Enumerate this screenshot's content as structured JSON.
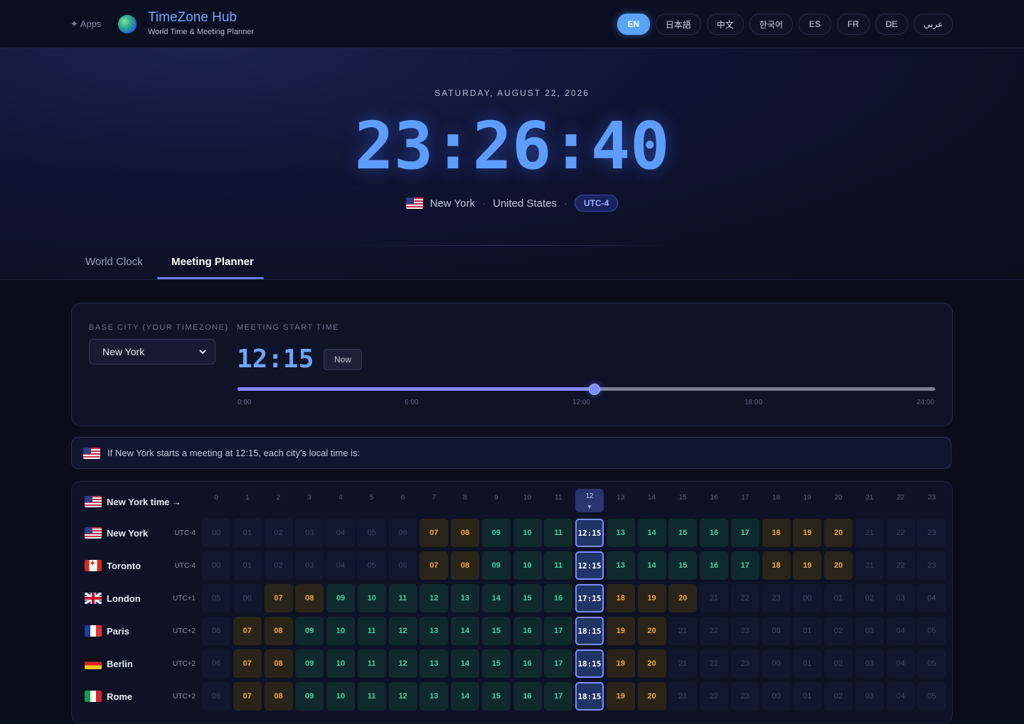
{
  "header": {
    "apps_label": "✦ Apps",
    "brand_title": "TimeZone Hub",
    "brand_subtitle": "World Time & Meeting Planner",
    "languages": [
      "EN",
      "日本語",
      "中文",
      "한국어",
      "ES",
      "FR",
      "DE",
      "عربي"
    ],
    "active_language": "EN"
  },
  "hero": {
    "date": "SATURDAY, AUGUST 22, 2026",
    "time": "23:26:40",
    "city": "New York",
    "country": "United States",
    "utc": "UTC-4"
  },
  "tabs": [
    "World Clock",
    "Meeting Planner"
  ],
  "active_tab": "Meeting Planner",
  "planner": {
    "base_label": "BASE CITY (YOUR TIMEZONE)",
    "base_city": "New York",
    "start_label": "MEETING START TIME",
    "start_time": "12:15",
    "now_label": "Now",
    "slider_value_hours": 12.25,
    "slider_max_hours": 24,
    "ticks": [
      "0:00",
      "6:00",
      "12:00",
      "18:00",
      "24:00"
    ],
    "info_text": "If New York starts a meeting at 12:15, each city's local time is:"
  },
  "grid": {
    "header_label": "New York time →",
    "hours": [
      "0",
      "1",
      "2",
      "3",
      "4",
      "5",
      "6",
      "7",
      "8",
      "9",
      "10",
      "11",
      "12",
      "13",
      "14",
      "15",
      "16",
      "17",
      "18",
      "19",
      "20",
      "21",
      "22",
      "23"
    ],
    "selected_hour_index": 12,
    "selected_marker": "▼",
    "rows": [
      {
        "city": "New York",
        "flag": "us",
        "utc": "UTC-4",
        "selected": "12:15",
        "cells": [
          "00",
          "01",
          "02",
          "03",
          "04",
          "05",
          "06",
          "07",
          "08",
          "09",
          "10",
          "11",
          "12:15",
          "13",
          "14",
          "15",
          "16",
          "17",
          "18",
          "19",
          "20",
          "21",
          "22",
          "23"
        ]
      },
      {
        "city": "Toronto",
        "flag": "ca",
        "utc": "UTC-4",
        "selected": "12:15",
        "cells": [
          "00",
          "01",
          "02",
          "03",
          "04",
          "05",
          "06",
          "07",
          "08",
          "09",
          "10",
          "11",
          "12:15",
          "13",
          "14",
          "15",
          "16",
          "17",
          "18",
          "19",
          "20",
          "21",
          "22",
          "23"
        ]
      },
      {
        "city": "London",
        "flag": "gb",
        "utc": "UTC+1",
        "selected": "17:15",
        "cells": [
          "05",
          "06",
          "07",
          "08",
          "09",
          "10",
          "11",
          "12",
          "13",
          "14",
          "15",
          "16",
          "17:15",
          "18",
          "19",
          "20",
          "21",
          "22",
          "23",
          "00",
          "01",
          "02",
          "03",
          "04"
        ]
      },
      {
        "city": "Paris",
        "flag": "fr",
        "utc": "UTC+2",
        "selected": "18:15",
        "cells": [
          "06",
          "07",
          "08",
          "09",
          "10",
          "11",
          "12",
          "13",
          "14",
          "15",
          "16",
          "17",
          "18:15",
          "19",
          "20",
          "21",
          "22",
          "23",
          "00",
          "01",
          "02",
          "03",
          "04",
          "05"
        ]
      },
      {
        "city": "Berlin",
        "flag": "de",
        "utc": "UTC+2",
        "selected": "18:15",
        "cells": [
          "06",
          "07",
          "08",
          "09",
          "10",
          "11",
          "12",
          "13",
          "14",
          "15",
          "16",
          "17",
          "18:15",
          "19",
          "20",
          "21",
          "22",
          "23",
          "00",
          "01",
          "02",
          "03",
          "04",
          "05"
        ]
      },
      {
        "city": "Rome",
        "flag": "it",
        "utc": "UTC+2",
        "selected": "18:15",
        "cells": [
          "06",
          "07",
          "08",
          "09",
          "10",
          "11",
          "12",
          "13",
          "14",
          "15",
          "16",
          "17",
          "18:15",
          "19",
          "20",
          "21",
          "22",
          "23",
          "00",
          "01",
          "02",
          "03",
          "04",
          "05"
        ]
      }
    ]
  }
}
